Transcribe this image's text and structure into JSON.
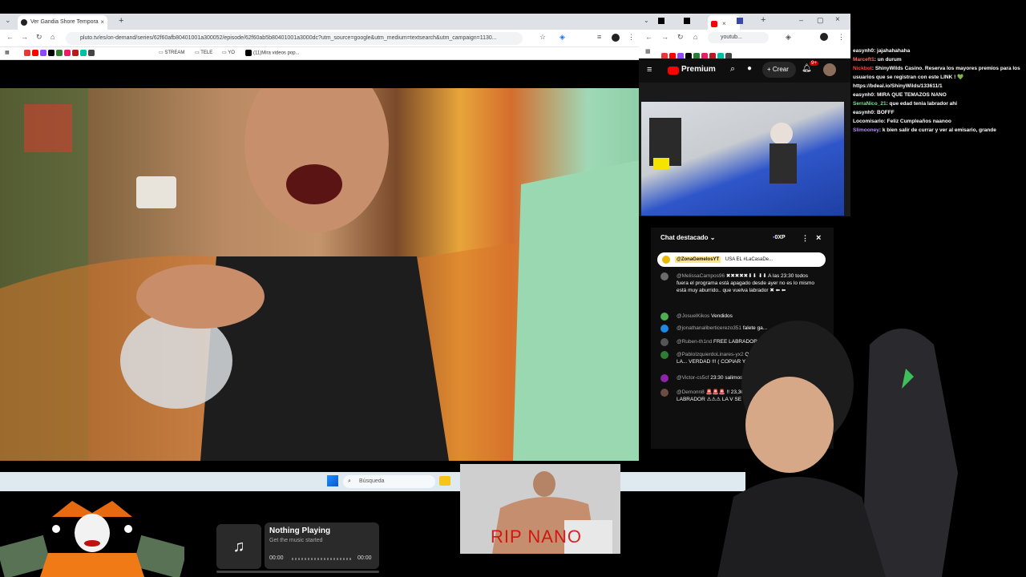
{
  "left_browser": {
    "tab_title": "Ver Gandia Shore Tempora",
    "url": "pluto.tv/es/on-demand/series/62f60afb80401001a300052/episode/62f60ab5b80401001a3000dc?utm_source=google&utm_medium=textsearch&utm_campaign=1130...",
    "bookmarks": [
      "STREAM",
      "TELE",
      "YO",
      "(11)Mira videos pop..."
    ]
  },
  "right_browser": {
    "url": "youtub...",
    "premium_label": "Premium",
    "create_label": "Crear",
    "notif_count": "9+"
  },
  "yt_chat": {
    "title": "Chat destacado",
    "points": "0XP",
    "pinned_user": "@ZonaGemelosYT",
    "pinned_text": "USA EL #LaCasaDe...",
    "messages": [
      {
        "user": "@MelissaCampos96",
        "text": "✖✖✖✖✖⬇⬇ ⬇⬇ A las 23:30 todos fuera el programa está apagado desde ayer no es lo mismo está muy aburrido.. que vuelva labrador ✖ ⬅ ⬅",
        "color": "#6b6b6b"
      },
      {
        "user": "@JosuelKikos",
        "text": "Vendidos",
        "color": "#4caf50"
      },
      {
        "user": "@jonathanaliberticerezo351",
        "text": "falete ga...",
        "color": "#1e88e5"
      },
      {
        "user": "@Ruben-th1nd",
        "text": "FREE LABRADOR",
        "color": "#555"
      },
      {
        "user": "@PabloIzquierdoLinares-yx2",
        "text": "QUE SEPAN QUIENES SON LA... VERDAD !!! ( COPIAR Y PEGA...",
        "color": "#2e7d32"
      },
      {
        "user": "@Victor-cs5cf",
        "text": "23:30 salimos...",
        "color": "#8e24aa"
      },
      {
        "user": "@Demonn8",
        "text": "🚨🚨🚨 ‼ 23,30 TODOS FU... ‼ FREE LABRADOR ⚠⚠⚠ LA V SE VA POR LABRADO...",
        "color": "#6d4c41"
      }
    ]
  },
  "twitch_chat": [
    {
      "user": "easynh0",
      "text": "jajahahahaha",
      "color": "#ffffff"
    },
    {
      "user": "Marceft1",
      "text": "un durum",
      "color": "#ff6b6b"
    },
    {
      "user": "Nickbot",
      "text": "ShinyWilds Casino. Reserva los mayores premios para los usuarios que se registran con este LINK ! 💚 https://bdeal.io/ShinyWilds/133611/1",
      "color": "#ff4444"
    },
    {
      "user": "easynh0",
      "text": "MIRA QUE TEMAZOS NANO",
      "color": "#ffffff"
    },
    {
      "user": "SerraNico_21",
      "text": "que edad tenia labrador ahi",
      "color": "#7fe3a0"
    },
    {
      "user": "easynh0",
      "text": "BOFFF",
      "color": "#ffffff"
    },
    {
      "user": "Locomisario",
      "text": "Feliz Cumpleaños naanoo",
      "color": "#ffffff"
    },
    {
      "user": "Slimooney",
      "text": "k bien salir de currar y ver al emisario, grande",
      "color": "#b18cff"
    }
  ],
  "taskbar": {
    "search_placeholder": "Búsqueda"
  },
  "music": {
    "title": "Nothing Playing",
    "subtitle": "Get the music started",
    "time_start": "00:00",
    "time_end": "00:00",
    "progress": 0
  },
  "rip_overlay": {
    "text": "RIP NANO"
  }
}
